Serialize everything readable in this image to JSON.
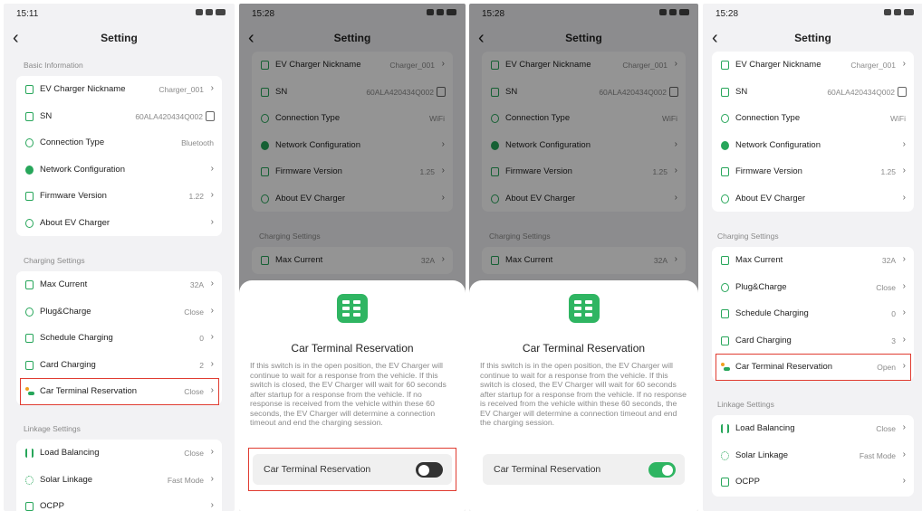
{
  "colors": {
    "accent": "#27a65a",
    "highlight": "#e03c31",
    "toggle_off": "#333333",
    "toggle_on": "#2fb562"
  },
  "panels": [
    {
      "time": "15:11",
      "title": "Setting",
      "basic_section": "Basic Information",
      "basic_items": [
        {
          "icon": "nickname-icon",
          "label": "EV Charger Nickname",
          "value": "Charger_001"
        },
        {
          "icon": "sn-icon",
          "label": "SN",
          "value": "60ALA420434Q002"
        },
        {
          "icon": "connection-icon",
          "label": "Connection Type",
          "value": "Bluetooth"
        },
        {
          "icon": "globe-icon",
          "label": "Network Configuration",
          "value": ""
        },
        {
          "icon": "firmware-icon",
          "label": "Firmware Version",
          "value": "1.22"
        },
        {
          "icon": "info-icon",
          "label": "About EV Charger",
          "value": ""
        }
      ],
      "charging_section": "Charging Settings",
      "charging_items": [
        {
          "icon": "max-current-icon",
          "label": "Max Current",
          "value": "32A"
        },
        {
          "icon": "plug-icon",
          "label": "Plug&Charge",
          "value": "Close"
        },
        {
          "icon": "schedule-icon",
          "label": "Schedule Charging",
          "value": "0"
        },
        {
          "icon": "card-icon",
          "label": "Card Charging",
          "value": "2"
        },
        {
          "icon": "car-icon",
          "label": "Car Terminal Reservation",
          "value": "Close"
        }
      ],
      "linkage_section": "Linkage Settings",
      "linkage_items": [
        {
          "icon": "load-balancing-icon",
          "label": "Load Balancing",
          "value": "Close"
        },
        {
          "icon": "solar-icon",
          "label": "Solar Linkage",
          "value": "Fast Mode"
        },
        {
          "icon": "ocpp-icon",
          "label": "OCPP",
          "value": ""
        }
      ]
    },
    {
      "time": "15:28",
      "title": "Setting",
      "basic_items": [
        {
          "icon": "nickname-icon",
          "label": "EV Charger Nickname",
          "value": "Charger_001"
        },
        {
          "icon": "sn-icon",
          "label": "SN",
          "value": "60ALA420434Q002"
        },
        {
          "icon": "connection-icon",
          "label": "Connection Type",
          "value": "WiFi"
        },
        {
          "icon": "globe-icon",
          "label": "Network Configuration",
          "value": ""
        },
        {
          "icon": "firmware-icon",
          "label": "Firmware Version",
          "value": "1.25"
        },
        {
          "icon": "info-icon",
          "label": "About EV Charger",
          "value": ""
        }
      ],
      "charging_section": "Charging Settings",
      "charging_items": [
        {
          "icon": "max-current-icon",
          "label": "Max Current",
          "value": "32A"
        }
      ],
      "sheet": {
        "title": "Car Terminal Reservation",
        "text": "If this switch is in the open position, the EV Charger will continue to wait for a response from the vehicle. If this switch is closed, the EV Charger will wait for 60 seconds after startup for a response from the vehicle. If no response is received from the vehicle within these 60 seconds, the EV Charger will determine a connection timeout and end the charging session.",
        "toggle_label": "Car Terminal Reservation",
        "toggle_on": false
      }
    },
    {
      "time": "15:28",
      "title": "Setting",
      "basic_items": [
        {
          "icon": "nickname-icon",
          "label": "EV Charger Nickname",
          "value": "Charger_001"
        },
        {
          "icon": "sn-icon",
          "label": "SN",
          "value": "60ALA420434Q002"
        },
        {
          "icon": "connection-icon",
          "label": "Connection Type",
          "value": "WiFi"
        },
        {
          "icon": "globe-icon",
          "label": "Network Configuration",
          "value": ""
        },
        {
          "icon": "firmware-icon",
          "label": "Firmware Version",
          "value": "1.25"
        },
        {
          "icon": "info-icon",
          "label": "About EV Charger",
          "value": ""
        }
      ],
      "charging_section": "Charging Settings",
      "charging_items": [
        {
          "icon": "max-current-icon",
          "label": "Max Current",
          "value": "32A"
        }
      ],
      "sheet": {
        "title": "Car Terminal Reservation",
        "text": "If this switch is in the open position, the EV Charger will continue to wait for a response from the vehicle. If this switch is closed, the EV Charger will wait for 60 seconds after startup for a response from the vehicle. If no response is received from the vehicle within these 60 seconds, the EV Charger will determine a connection timeout and end the charging session.",
        "toggle_label": "Car Terminal Reservation",
        "toggle_on": true
      }
    },
    {
      "time": "15:28",
      "title": "Setting",
      "basic_items": [
        {
          "icon": "nickname-icon",
          "label": "EV Charger Nickname",
          "value": "Charger_001"
        },
        {
          "icon": "sn-icon",
          "label": "SN",
          "value": "60ALA420434Q002"
        },
        {
          "icon": "connection-icon",
          "label": "Connection Type",
          "value": "WiFi"
        },
        {
          "icon": "globe-icon",
          "label": "Network Configuration",
          "value": ""
        },
        {
          "icon": "firmware-icon",
          "label": "Firmware Version",
          "value": "1.25"
        },
        {
          "icon": "info-icon",
          "label": "About EV Charger",
          "value": ""
        }
      ],
      "charging_section": "Charging Settings",
      "charging_items": [
        {
          "icon": "max-current-icon",
          "label": "Max Current",
          "value": "32A"
        },
        {
          "icon": "plug-icon",
          "label": "Plug&Charge",
          "value": "Close"
        },
        {
          "icon": "schedule-icon",
          "label": "Schedule Charging",
          "value": "0"
        },
        {
          "icon": "card-icon",
          "label": "Card Charging",
          "value": "3"
        },
        {
          "icon": "car-icon",
          "label": "Car Terminal Reservation",
          "value": "Open"
        }
      ],
      "linkage_section": "Linkage Settings",
      "linkage_items": [
        {
          "icon": "load-balancing-icon",
          "label": "Load Balancing",
          "value": "Close"
        },
        {
          "icon": "solar-icon",
          "label": "Solar Linkage",
          "value": "Fast Mode"
        },
        {
          "icon": "ocpp-icon",
          "label": "OCPP",
          "value": ""
        }
      ]
    }
  ]
}
